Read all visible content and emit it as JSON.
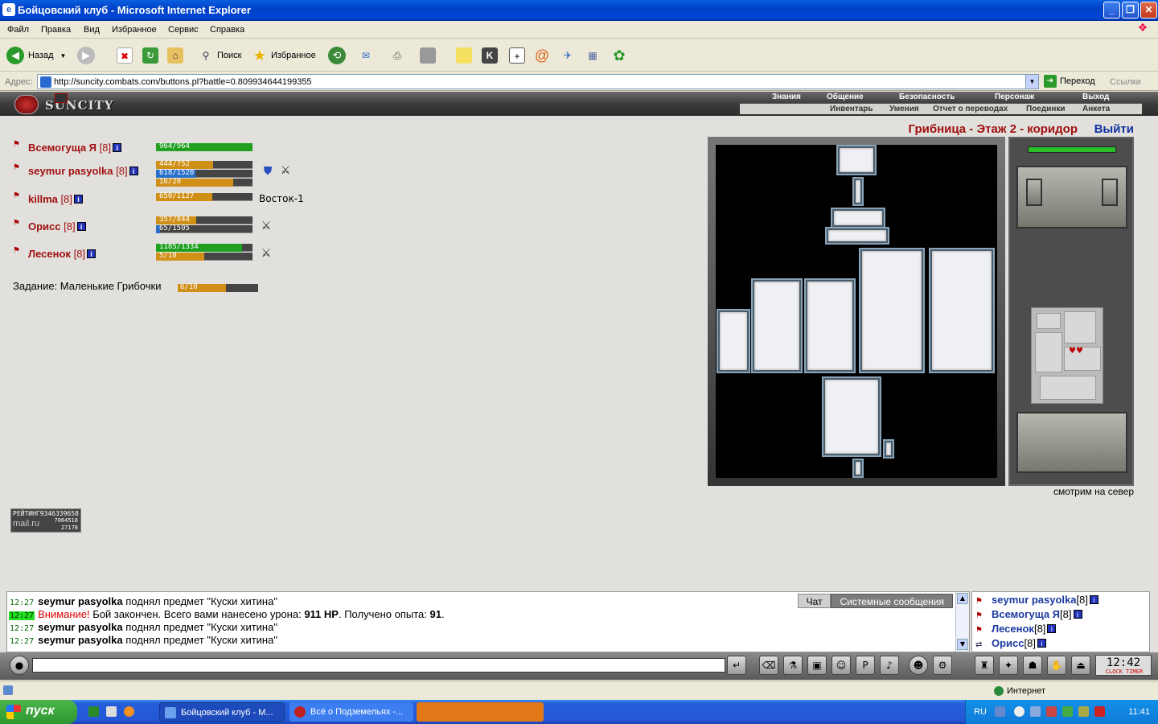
{
  "window": {
    "title": "Бойцовский клуб - Microsoft Internet Explorer"
  },
  "menu": [
    "Файл",
    "Правка",
    "Вид",
    "Избранное",
    "Сервис",
    "Справка"
  ],
  "toolbar": {
    "back_label": "Назад",
    "search_label": "Поиск",
    "favorites_label": "Избранное"
  },
  "address": {
    "label": "Адрес:",
    "url": "http://suncity.combats.com/buttons.pl?battle=0.809934644199355",
    "go_label": "Переход",
    "links_label": "Ссылки"
  },
  "game": {
    "logo": "SUNCITY",
    "top_menu": [
      "Знания",
      "Общение",
      "Безопасность",
      "Персонаж",
      "Выход"
    ],
    "sub_menu": [
      "Инвентарь",
      "Умения",
      "Отчет о переводах",
      "Поединки",
      "Анкета"
    ],
    "location": "Грибница - Этаж 2 - коридор",
    "exit_label": "Выйти",
    "facing": "смотрим на север",
    "players": [
      {
        "name": "Всемогуща Я",
        "level": "[8]",
        "bars": [
          {
            "text": "964/964",
            "fill": 1.0,
            "color": "#20a020"
          }
        ],
        "extra": ""
      },
      {
        "name": "seymur pasyolka",
        "level": "[8]",
        "bars": [
          {
            "text": "444/752",
            "fill": 0.59,
            "color": "#d09018"
          },
          {
            "text": "618/1520",
            "fill": 0.41,
            "color": "#2a70c8"
          },
          {
            "text": "16/20",
            "fill": 0.8,
            "color": "#d09018"
          }
        ],
        "extra": ""
      },
      {
        "name": "killma",
        "level": "[8]",
        "bars": [
          {
            "text": "650/1127",
            "fill": 0.58,
            "color": "#d09018"
          }
        ],
        "extra": "Восток-1"
      },
      {
        "name": "Орисс",
        "level": "[8]",
        "bars": [
          {
            "text": "357/844",
            "fill": 0.42,
            "color": "#d09018"
          },
          {
            "text": "65/1505",
            "fill": 0.04,
            "color": "#2a70c8"
          }
        ],
        "extra": ""
      },
      {
        "name": "Лесенок",
        "level": "[8]",
        "bars": [
          {
            "text": "1185/1334",
            "fill": 0.89,
            "color": "#20a020"
          },
          {
            "text": "5/10",
            "fill": 0.5,
            "color": "#d09018"
          }
        ],
        "extra": ""
      }
    ],
    "task": {
      "label": "Задание: Маленькие Грибочки",
      "progress_text": "6/10",
      "progress": 0.6
    },
    "counter": {
      "line1": "РЕЙТИНГ9346339658",
      "brand": "mail.ru",
      "n1": "7064518",
      "n2": "27178"
    }
  },
  "chat": {
    "tabs": [
      "Чат",
      "Системные сообщения"
    ],
    "lines": [
      {
        "time": "12:27",
        "highlight": false,
        "who": "seymur pasyolka",
        "text": "поднял предмет \"Куски хитина\""
      },
      {
        "time": "12:27",
        "highlight": true,
        "warn": "Внимание!",
        "text": "Бой закончен. Всего вами нанесено урона:",
        "dmg": "911 HP",
        "text2": ". Получено опыта:",
        "exp": "91",
        "end": "."
      },
      {
        "time": "12:27",
        "highlight": false,
        "who": "seymur pasyolka",
        "text": "поднял предмет \"Куски хитина\""
      },
      {
        "time": "12:27",
        "highlight": false,
        "who": "seymur pasyolka",
        "text": "поднял предмет \"Куски хитина\""
      }
    ]
  },
  "online": [
    {
      "name": "seymur pasyolka",
      "level": "[8]"
    },
    {
      "name": "Всемогуща Я",
      "level": "[8]"
    },
    {
      "name": "Лесенок",
      "level": "[8]"
    },
    {
      "name": "Орисс",
      "level": "[8]"
    }
  ],
  "clock": {
    "time": "12:42",
    "label": "CLOCK TIMER"
  },
  "status": {
    "zone": "Интернет"
  },
  "taskbar": {
    "start": "пуск",
    "tasks": [
      "Бойцовский клуб - M...",
      "Всё о Подземельях -..."
    ],
    "lang": "RU",
    "time": "11:41"
  }
}
